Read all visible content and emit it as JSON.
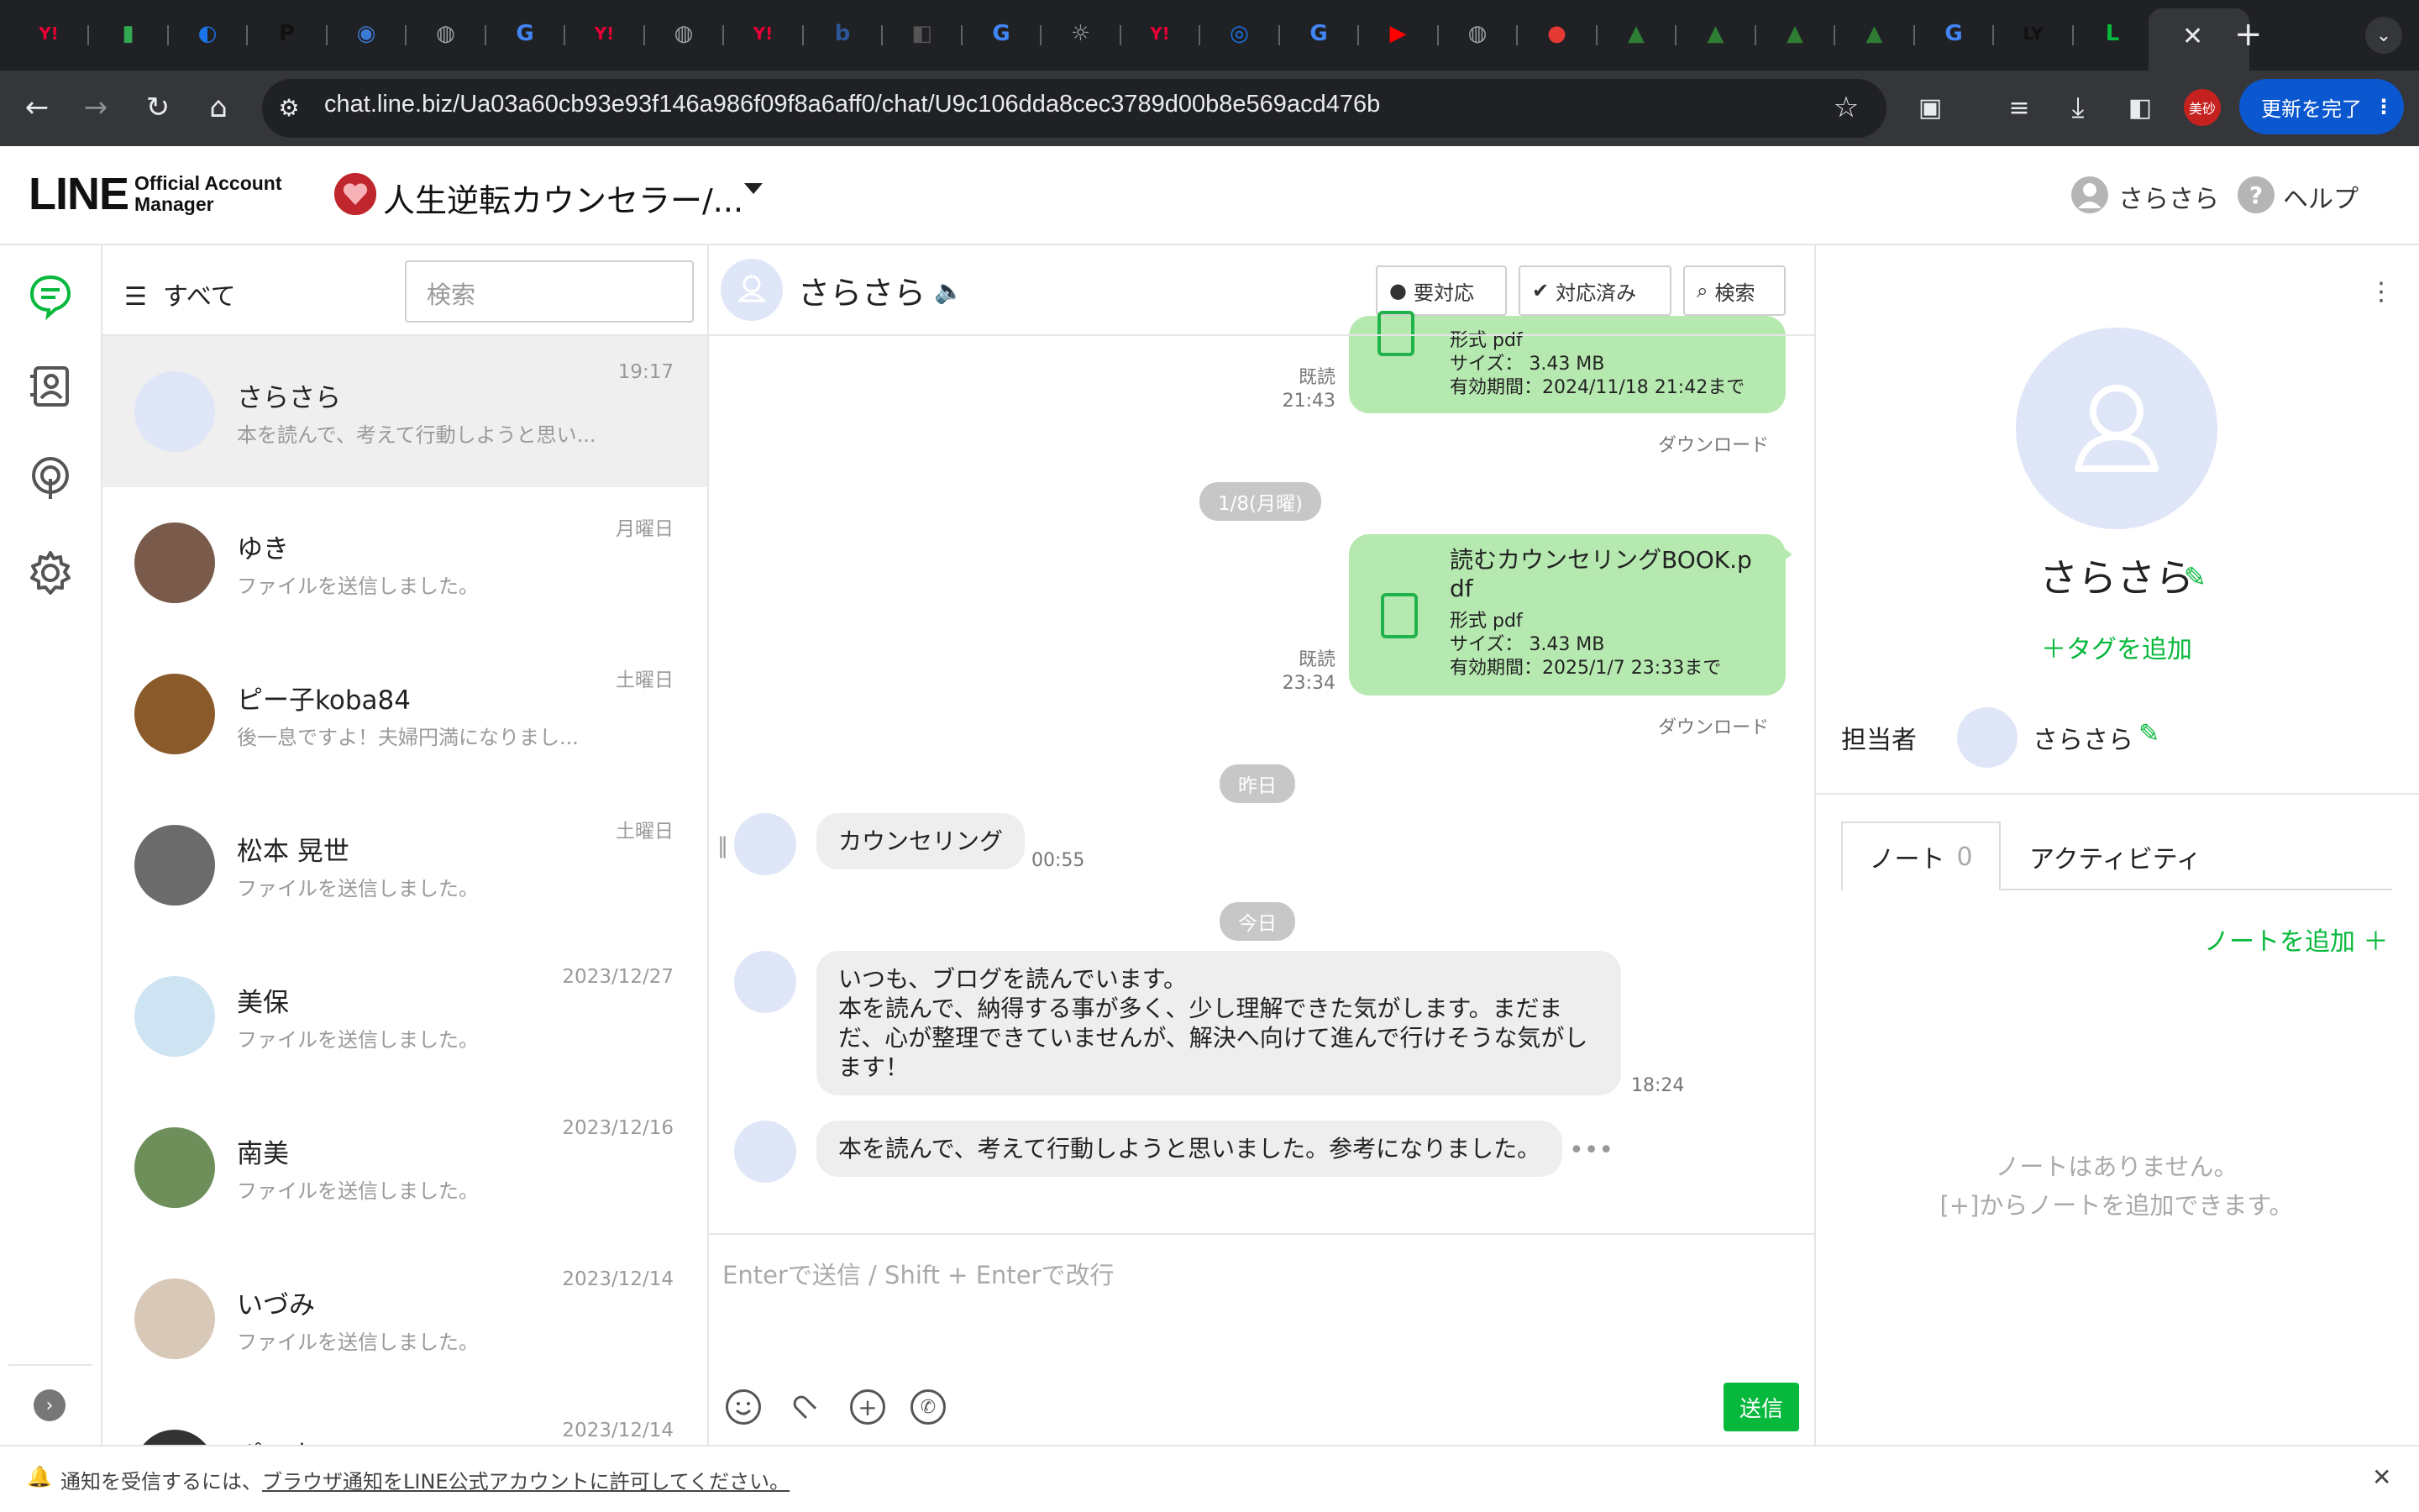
{
  "browser": {
    "url": "chat.line.biz/Ua03a60cb93e93f146a986f09f8a6aff0/chat/U9c106dda8cec3789d00b8e569acd476b",
    "update_button": "更新を完了",
    "profile_badge": "美砂",
    "tab_favicons": [
      {
        "glyph": "Y!",
        "color": "#e60033"
      },
      {
        "glyph": "▮",
        "color": "#32a852"
      },
      {
        "glyph": "◐",
        "color": "#1a73e8"
      },
      {
        "glyph": "P",
        "color": "#111111"
      },
      {
        "glyph": "◉",
        "color": "#3a7bd5"
      },
      {
        "glyph": "◍",
        "color": "#9aa0a6"
      },
      {
        "glyph": "G",
        "color": "#4285f4"
      },
      {
        "glyph": "Y!",
        "color": "#e60033"
      },
      {
        "glyph": "◍",
        "color": "#9aa0a6"
      },
      {
        "glyph": "Y!",
        "color": "#e60033"
      },
      {
        "glyph": "b",
        "color": "#2b5797"
      },
      {
        "glyph": "◧",
        "color": "#555555"
      },
      {
        "glyph": "G",
        "color": "#4285f4"
      },
      {
        "glyph": "☼",
        "color": "#9aa0a6"
      },
      {
        "glyph": "Y!",
        "color": "#e60033"
      },
      {
        "glyph": "◎",
        "color": "#1a73e8"
      },
      {
        "glyph": "G",
        "color": "#4285f4"
      },
      {
        "glyph": "▶",
        "color": "#ff0000"
      },
      {
        "glyph": "◍",
        "color": "#9aa0a6"
      },
      {
        "glyph": "●",
        "color": "#e53935"
      },
      {
        "glyph": "▲",
        "color": "#2e7d32"
      },
      {
        "glyph": "▲",
        "color": "#2e7d32"
      },
      {
        "glyph": "▲",
        "color": "#2e7d32"
      },
      {
        "glyph": "▲",
        "color": "#2e7d32"
      },
      {
        "glyph": "G",
        "color": "#4285f4"
      },
      {
        "glyph": "LY",
        "color": "#111111"
      },
      {
        "glyph": "L",
        "color": "#06b83b"
      }
    ]
  },
  "header": {
    "logo": "LINE",
    "logo_sub_1": "Official Account",
    "logo_sub_2": "Manager",
    "account_name": "人生逆転カウンセラー/...",
    "user_name": "さらさら",
    "help_label": "ヘルプ"
  },
  "list": {
    "filter_label": "すべて",
    "search_placeholder": "検索",
    "items": [
      {
        "name": "さらさら",
        "preview": "本を読んで、考えて行動しようと思い...",
        "time": "19:17"
      },
      {
        "name": "ゆき",
        "preview": "ファイルを送信しました。",
        "time": "月曜日"
      },
      {
        "name": "ピー子koba84",
        "preview": "後一息ですよ！夫婦円満になりまし...",
        "time": "土曜日"
      },
      {
        "name": "松本 晃世",
        "preview": "ファイルを送信しました。",
        "time": "土曜日"
      },
      {
        "name": "美保",
        "preview": "ファイルを送信しました。",
        "time": "2023/12/27"
      },
      {
        "name": "南美",
        "preview": "ファイルを送信しました。",
        "time": "2023/12/16"
      },
      {
        "name": "いづみ",
        "preview": "ファイルを送信しました。",
        "time": "2023/12/14"
      },
      {
        "name": "ポン太",
        "preview": "",
        "time": "2023/12/14"
      }
    ]
  },
  "chat": {
    "title": "さらさら",
    "btn_needs_action": "要対応",
    "btn_done": "対応済み",
    "btn_search": "検索",
    "file1": {
      "format": "形式 pdf",
      "size": "サイズ： 3.43 MB",
      "expiry": "有効期間：2024/11/18 21:42まで",
      "read": "既読",
      "time": "21:43",
      "download": "ダウンロード"
    },
    "date1": "1/8(月曜)",
    "file2": {
      "name": "読むカウンセリングBOOK.pdf",
      "format": "形式 pdf",
      "size": "サイズ： 3.43 MB",
      "expiry": "有効期間：2025/1/7 23:33まで",
      "read": "既読",
      "time": "23:34",
      "download": "ダウンロード"
    },
    "date2": "昨日",
    "msg1": {
      "text": "カウンセリング",
      "time": "00:55"
    },
    "date3": "今日",
    "msg2": {
      "text": "いつも、ブログを読んでいます。\n本を読んで、納得する事が多く、少し理解できた気がします。まだまだ、心が整理できていませんが、解決へ向けて進んで行けそうな気がします！",
      "time": "18:24"
    },
    "msg3": {
      "text": "本を読んで、考えて行動しようと思いました。参考になりました。"
    },
    "composer_placeholder": "Enterで送信 / Shift + Enterで改行",
    "send_label": "送信"
  },
  "profile": {
    "name": "さらさら",
    "add_tag": "＋タグを追加",
    "owner_label": "担当者",
    "owner_name": "さらさら",
    "tab_note": "ノート",
    "tab_note_count": "0",
    "tab_activity": "アクティビティ",
    "add_note": "ノートを追加 ＋",
    "empty_line1": "ノートはありません。",
    "empty_line2": "[+]からノートを追加できます。"
  },
  "notice": {
    "prefix": "通知を受信するには、",
    "link": "ブラウザ通知をLINE公式アカウントに許可してください。"
  },
  "colors": {
    "accent": "#06b83b",
    "bubble_out": "#b6e9b0",
    "bubble_in": "#eeeeee"
  }
}
